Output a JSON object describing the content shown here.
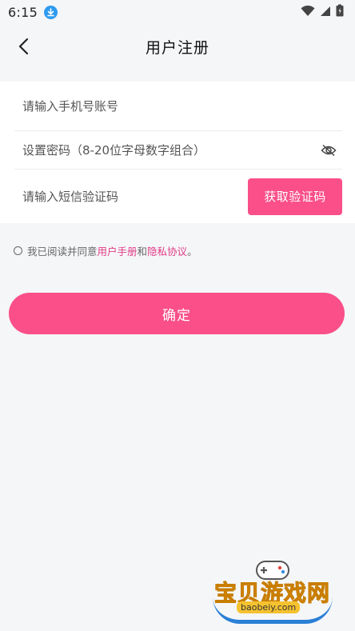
{
  "status_bar": {
    "time": "6:15"
  },
  "header": {
    "title": "用户注册"
  },
  "form": {
    "phone_placeholder": "请输入手机号账号",
    "password_placeholder": "设置密码（8-20位字母数字组合）",
    "code_placeholder": "请输入短信验证码",
    "get_code_label": "获取验证码"
  },
  "agreement": {
    "prefix": "我已阅读并同意",
    "user_manual": "用户手册",
    "and": "和",
    "privacy": "隐私协议",
    "suffix": "。"
  },
  "confirm_label": "确定",
  "watermark": {
    "brand": "宝贝游戏网",
    "url": "baobeiy.com"
  },
  "colors": {
    "accent": "#fa4f88",
    "link": "#e23b87",
    "background": "#f5f6f8"
  }
}
